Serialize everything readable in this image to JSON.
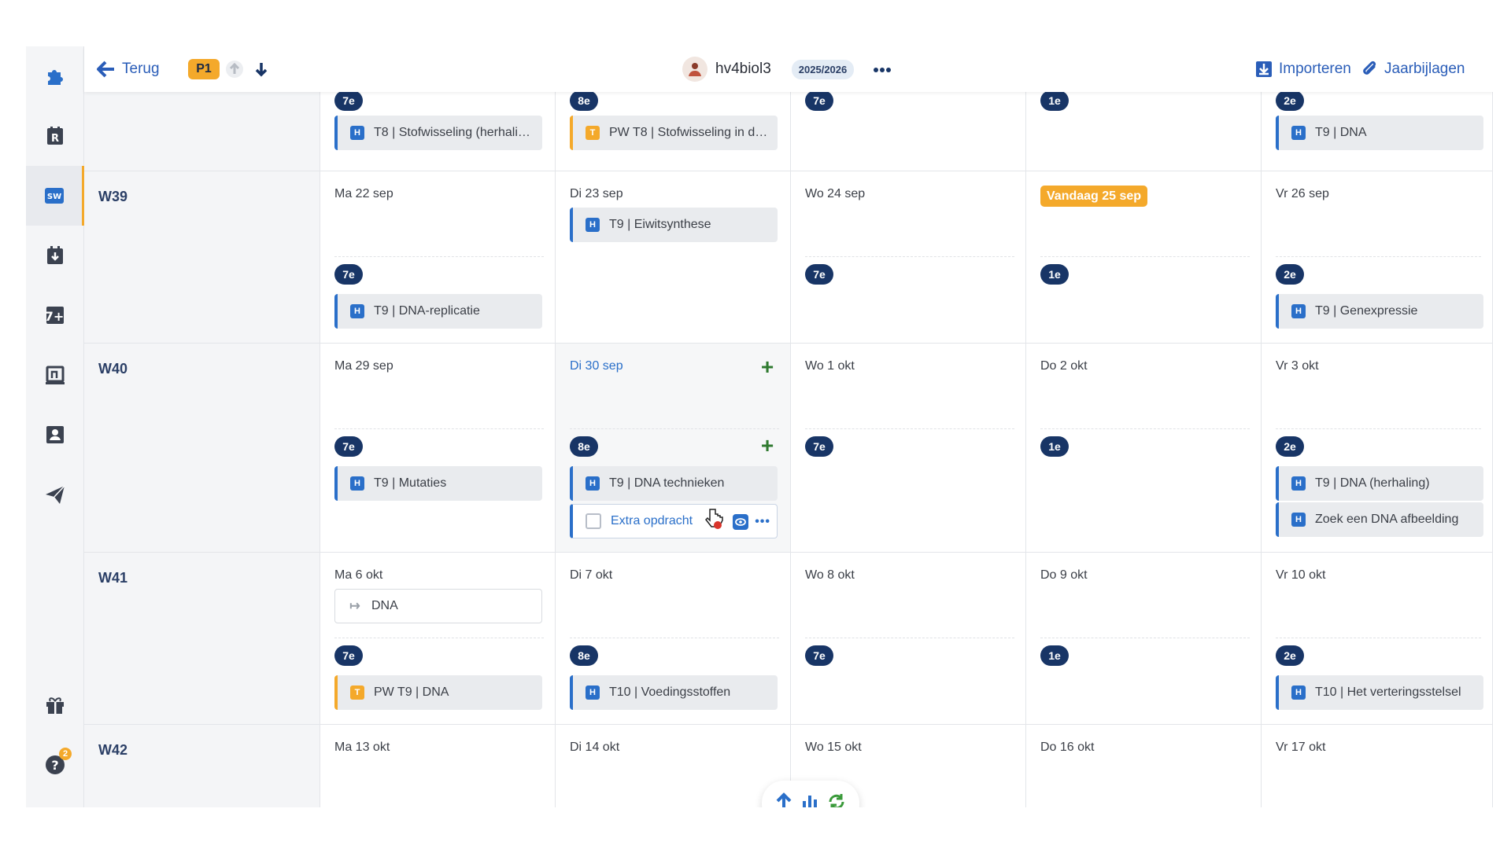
{
  "topbar": {
    "back_label": "Terug",
    "period": "P1",
    "user_name": "hv4biol3",
    "school_year": "2025/2026",
    "import_label": "Importeren",
    "attachments_label": "Jaarbijlagen"
  },
  "sidebar": {
    "items": [
      {
        "icon": "puzzle-icon"
      },
      {
        "icon": "roster-r-icon"
      },
      {
        "icon": "sw-icon",
        "label": "SW",
        "active": true
      },
      {
        "icon": "calendar-download-icon"
      },
      {
        "icon": "grade-7plus-icon",
        "label": "7+"
      },
      {
        "icon": "n-board-icon"
      },
      {
        "icon": "contact-card-icon"
      },
      {
        "icon": "send-plane-icon"
      },
      {
        "icon": "gift-icon"
      },
      {
        "icon": "help-icon",
        "badge": "2"
      }
    ]
  },
  "weeks": [
    {
      "label": "",
      "days": [
        {
          "date": "",
          "slots": [
            {
              "class": "7e",
              "cards": [
                {
                  "type": "H",
                  "text": "T8 | Stofwisseling (herhalin..."
                }
              ]
            }
          ]
        },
        {
          "date": "",
          "slots": [
            {
              "class": "8e",
              "cards": [
                {
                  "type": "T",
                  "text": "PW T8 | Stofwisseling in de..."
                }
              ]
            }
          ]
        },
        {
          "date": "",
          "slots": [
            {
              "class": "7e",
              "cards": []
            }
          ]
        },
        {
          "date": "",
          "slots": [
            {
              "class": "1e",
              "cards": []
            }
          ]
        },
        {
          "date": "",
          "slots": [
            {
              "class": "2e",
              "cards": [
                {
                  "type": "H",
                  "text": "T9 | DNA"
                }
              ]
            }
          ]
        }
      ]
    },
    {
      "label": "W39",
      "days": [
        {
          "date": "Ma 22 sep",
          "top_cards": [],
          "class": "7e",
          "cards": [
            {
              "type": "H",
              "text": "T9 | DNA-replicatie"
            }
          ]
        },
        {
          "date": "Di 23 sep",
          "top_cards": [
            {
              "type": "H",
              "text": "T9 | Eiwitsynthese"
            }
          ],
          "class": "",
          "cards": []
        },
        {
          "date": "Wo 24 sep",
          "top_cards": [],
          "class": "7e",
          "cards": []
        },
        {
          "date": "Vandaag 25 sep",
          "today": true,
          "top_cards": [],
          "class": "1e",
          "cards": []
        },
        {
          "date": "Vr 26 sep",
          "top_cards": [],
          "class": "2e",
          "cards": [
            {
              "type": "H",
              "text": "T9 | Genexpressie"
            }
          ]
        }
      ]
    },
    {
      "label": "W40",
      "days": [
        {
          "date": "Ma 29 sep",
          "class": "7e",
          "cards": [
            {
              "type": "H",
              "text": "T9 | Mutaties"
            }
          ]
        },
        {
          "date": "Di 30 sep",
          "class": "8e",
          "cards": [
            {
              "type": "H",
              "text": "T9 | DNA technieken"
            }
          ],
          "task": "Extra opdracht"
        },
        {
          "date": "Wo 1 okt",
          "class": "7e",
          "cards": []
        },
        {
          "date": "Do 2 okt",
          "class": "1e",
          "cards": []
        },
        {
          "date": "Vr 3 okt",
          "class": "2e",
          "cards": [
            {
              "type": "H",
              "text": "T9 | DNA (herhaling)"
            },
            {
              "type": "H",
              "text": "Zoek een DNA afbeelding"
            }
          ]
        }
      ]
    },
    {
      "label": "W41",
      "days": [
        {
          "date": "Ma 6 okt",
          "top_cards": [
            {
              "type": "arrow",
              "text": "DNA"
            }
          ],
          "class": "7e",
          "cards": [
            {
              "type": "T",
              "text": "PW T9 | DNA"
            }
          ]
        },
        {
          "date": "Di 7 okt",
          "top_cards": [],
          "class": "8e",
          "cards": [
            {
              "type": "H",
              "text": "T10 | Voedingsstoffen"
            }
          ]
        },
        {
          "date": "Wo 8 okt",
          "top_cards": [],
          "class": "7e",
          "cards": []
        },
        {
          "date": "Do 9 okt",
          "top_cards": [],
          "class": "1e",
          "cards": []
        },
        {
          "date": "Vr 10 okt",
          "top_cards": [],
          "class": "2e",
          "cards": [
            {
              "type": "H",
              "text": "T10 | Het verteringsstelsel"
            }
          ]
        }
      ]
    },
    {
      "label": "W42",
      "days": [
        {
          "date": "Ma 13 okt"
        },
        {
          "date": "Di 14 okt"
        },
        {
          "date": "Wo 15 okt"
        },
        {
          "date": "Do 16 okt"
        },
        {
          "date": "Vr 17 okt"
        }
      ]
    }
  ],
  "colors": {
    "accent_blue": "#2a6fc9",
    "accent_orange": "#f4a92b",
    "badge_navy": "#183566"
  }
}
